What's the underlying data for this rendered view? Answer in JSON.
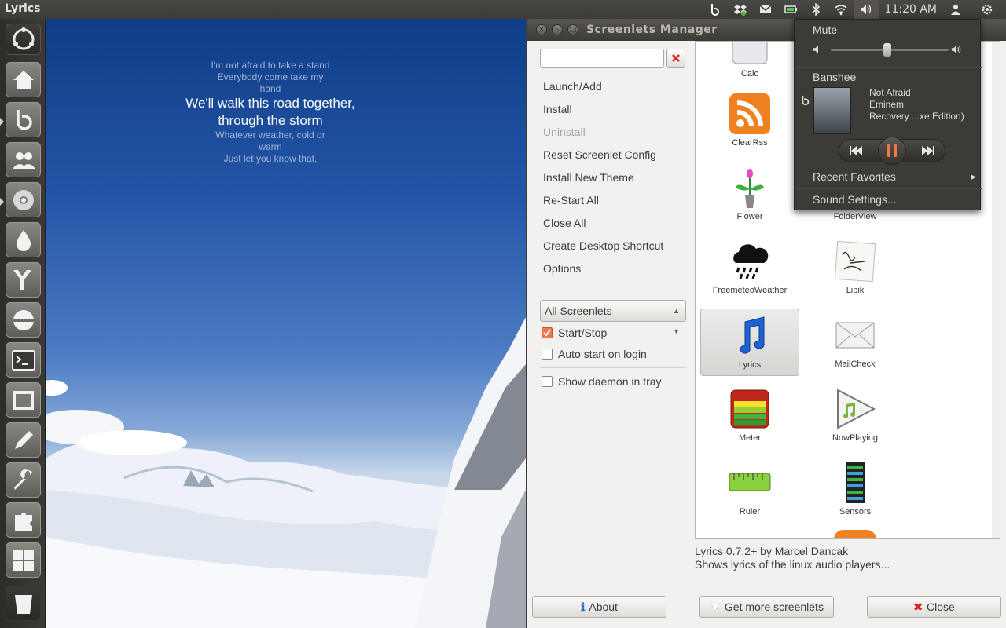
{
  "panel": {
    "app_title": "Lyrics",
    "clock": "11:20 AM",
    "icons": [
      "banshee-icon",
      "dropbox-icon",
      "mail-icon",
      "battery-icon",
      "bluetooth-icon",
      "wifi-icon",
      "volume-icon",
      "user-icon",
      "session-gear-icon"
    ]
  },
  "launcher": {
    "items": [
      "dash-home",
      "home-folder",
      "banshee",
      "empathy",
      "chromium",
      "ink-drop",
      "y-ppa-manager",
      "disk-utility",
      "terminal",
      "workspaces",
      "text-editor",
      "system-settings",
      "puzzle-addon",
      "workspace-switcher",
      "trash"
    ]
  },
  "lyrics": {
    "before": [
      "I'm not afraid to take a stand",
      "Everybody come take my",
      "hand"
    ],
    "current": [
      "We'll walk this road together,",
      "through the storm"
    ],
    "after": [
      "Whatever weather, cold or",
      "warm",
      "Just let you know that,"
    ]
  },
  "window": {
    "title": "Screenlets Manager",
    "search_value": "",
    "menu": [
      {
        "label": "Launch/Add",
        "enabled": true
      },
      {
        "label": "Install",
        "enabled": true
      },
      {
        "label": "Uninstall",
        "enabled": false
      },
      {
        "label": "Reset Screenlet Config",
        "enabled": true
      },
      {
        "label": "Install New Theme",
        "enabled": true
      },
      {
        "label": "Re-Start All",
        "enabled": true
      },
      {
        "label": "Close All",
        "enabled": true
      },
      {
        "label": "Create Desktop Shortcut",
        "enabled": true
      },
      {
        "label": "Options",
        "enabled": true
      }
    ],
    "filter_selected": "All Screenlets",
    "checkboxes": [
      {
        "label": "Start/Stop",
        "checked": true
      },
      {
        "label": "Auto start on login",
        "checked": false
      },
      {
        "label": "Show daemon in tray",
        "checked": false
      }
    ],
    "screenlets": [
      "Calc",
      "ClearRss",
      "Flower",
      "FolderView",
      "FreemeteoWeather",
      "Lipik",
      "Lyrics",
      "MailCheck",
      "Meter",
      "NowPlaying",
      "Ruler",
      "Sensors"
    ],
    "selected_screenlet": "Lyrics",
    "info_line1": "Lyrics 0.7.2+ by Marcel Dancak",
    "info_line2": "Shows lyrics of the linux audio players...",
    "about_label": "About",
    "more_label": "Get more screenlets",
    "close_label": "Close"
  },
  "sound_menu": {
    "mute_label": "Mute",
    "volume_level": 0.48,
    "player": "Banshee",
    "track": "Not Afraid",
    "artist": "Eminem",
    "album": "Recovery ...xe Edition)",
    "recent_label": "Recent Favorites",
    "settings_label": "Sound Settings..."
  },
  "colors": {
    "accent": "#f07746",
    "panel": "#3c3b37",
    "sky": "#2456a8"
  }
}
